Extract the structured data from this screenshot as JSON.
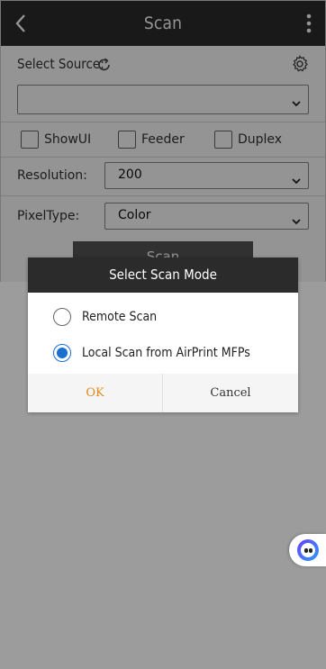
{
  "header": {
    "title": "Scan"
  },
  "source": {
    "label": "Select Source:",
    "selected": ""
  },
  "checkboxes": [
    {
      "label": "ShowUI",
      "checked": false
    },
    {
      "label": "Feeder",
      "checked": false
    },
    {
      "label": "Duplex",
      "checked": false
    }
  ],
  "resolution": {
    "label": "Resolution:",
    "value": "200"
  },
  "pixeltype": {
    "label": "PixelType:",
    "value": "Color"
  },
  "scan_button": {
    "label": "Scan"
  },
  "dialog": {
    "title": "Select Scan Mode",
    "options": [
      {
        "label": "Remote Scan",
        "selected": false
      },
      {
        "label": "Local Scan from AirPrint MFPs",
        "selected": true
      }
    ],
    "ok": "OK",
    "cancel": "Cancel"
  },
  "colors": {
    "header_bg": "#2b2b2b",
    "radio_selected": "#1b6fcf",
    "ok_text": "#e08a1e"
  }
}
